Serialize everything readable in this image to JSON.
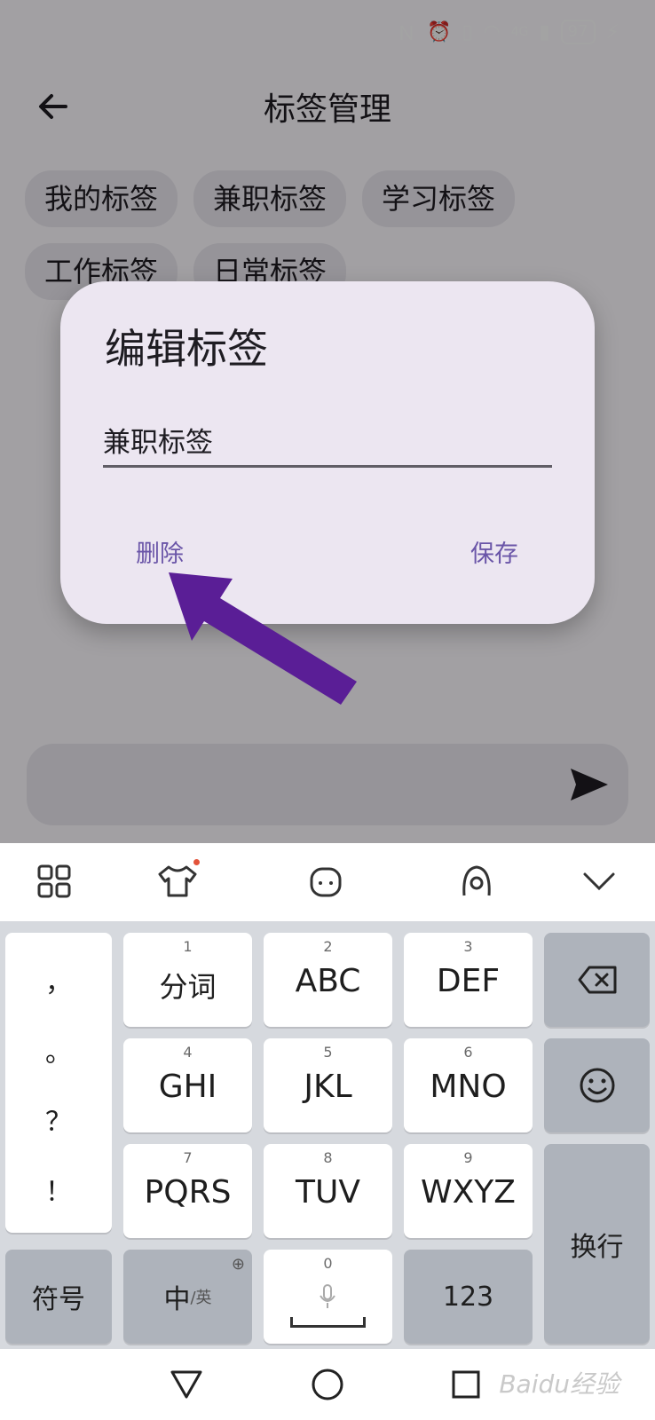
{
  "status_bar": {
    "icons": [
      "nfc-icon",
      "alarm-icon",
      "vibrate-icon",
      "wifi-icon",
      "signal-icon"
    ],
    "network": "4G",
    "battery": "97"
  },
  "header": {
    "title": "标签管理",
    "back_icon": "arrow-left-icon"
  },
  "tags": [
    {
      "label": "我的标签"
    },
    {
      "label": "兼职标签"
    },
    {
      "label": "学习标签"
    },
    {
      "label": "工作标签"
    },
    {
      "label": "日常标签"
    }
  ],
  "dialog": {
    "title": "编辑标签",
    "input_value": "兼职标签",
    "delete_label": "删除",
    "save_label": "保存"
  },
  "annotation": {
    "color": "#5a1e96"
  },
  "keyboard": {
    "toolbar_icons": [
      "grid-icon",
      "skin-icon",
      "emoji-face-icon",
      "voice-assistant-icon",
      "chevron-down-icon"
    ],
    "punct_keys": [
      "，",
      "。",
      "？",
      "！"
    ],
    "keys": [
      {
        "num": "1",
        "label": "分词"
      },
      {
        "num": "2",
        "label": "ABC"
      },
      {
        "num": "3",
        "label": "DEF"
      },
      {
        "num": "4",
        "label": "GHI"
      },
      {
        "num": "5",
        "label": "JKL"
      },
      {
        "num": "6",
        "label": "MNO"
      },
      {
        "num": "7",
        "label": "PQRS"
      },
      {
        "num": "8",
        "label": "TUV"
      },
      {
        "num": "9",
        "label": "WXYZ"
      }
    ],
    "symbols_label": "符号",
    "lang_main": "中",
    "lang_alt": "/英",
    "space_num": "0",
    "numeric_label": "123",
    "enter_label": "换行"
  },
  "nav": {
    "icons": [
      "back-triangle-icon",
      "home-circle-icon",
      "recents-square-icon"
    ]
  },
  "watermark": "Baidu经验"
}
